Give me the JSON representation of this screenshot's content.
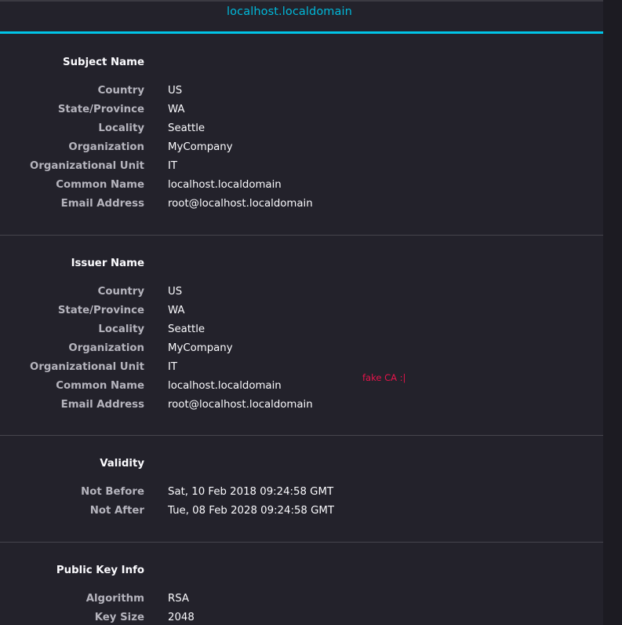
{
  "tab": {
    "title": "localhost.localdomain"
  },
  "subject": {
    "heading": "Subject Name",
    "rows": [
      {
        "label": "Country",
        "value": "US"
      },
      {
        "label": "State/Province",
        "value": "WA"
      },
      {
        "label": "Locality",
        "value": "Seattle"
      },
      {
        "label": "Organization",
        "value": "MyCompany"
      },
      {
        "label": "Organizational Unit",
        "value": "IT"
      },
      {
        "label": "Common Name",
        "value": "localhost.localdomain"
      },
      {
        "label": "Email Address",
        "value": "root@localhost.localdomain"
      }
    ]
  },
  "issuer": {
    "heading": "Issuer Name",
    "rows": [
      {
        "label": "Country",
        "value": "US"
      },
      {
        "label": "State/Province",
        "value": "WA"
      },
      {
        "label": "Locality",
        "value": "Seattle"
      },
      {
        "label": "Organization",
        "value": "MyCompany"
      },
      {
        "label": "Organizational Unit",
        "value": "IT"
      },
      {
        "label": "Common Name",
        "value": "localhost.localdomain"
      },
      {
        "label": "Email Address",
        "value": "root@localhost.localdomain"
      }
    ]
  },
  "validity": {
    "heading": "Validity",
    "rows": [
      {
        "label": "Not Before",
        "value": "Sat, 10 Feb 2018 09:24:58 GMT"
      },
      {
        "label": "Not After",
        "value": "Tue, 08 Feb 2028 09:24:58 GMT"
      }
    ]
  },
  "public_key": {
    "heading": "Public Key Info",
    "rows": [
      {
        "label": "Algorithm",
        "value": "RSA"
      },
      {
        "label": "Key Size",
        "value": "2048"
      }
    ]
  },
  "annotation": {
    "text": "fake CA :|"
  },
  "colors": {
    "accent": "#00c5e8",
    "background": "#23222b",
    "annotation": "#e5144b"
  }
}
